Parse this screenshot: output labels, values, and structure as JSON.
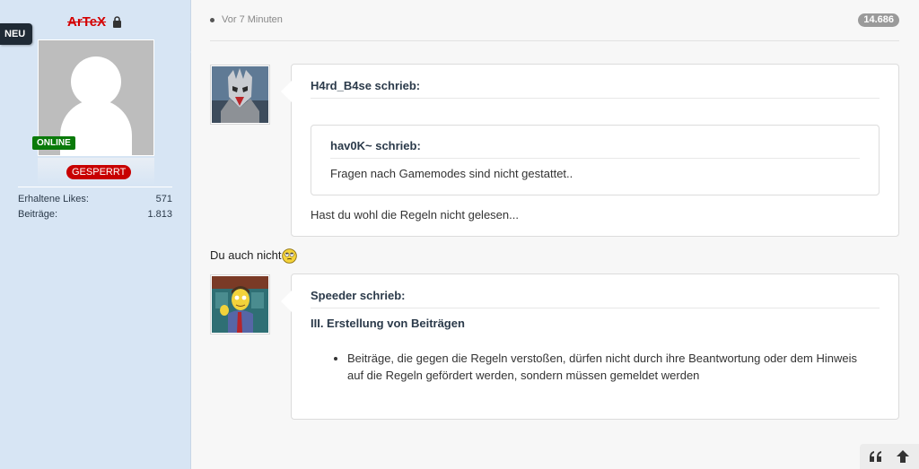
{
  "sidebar": {
    "new_label": "NEU",
    "username": "ArTeX",
    "online_label": "ONLINE",
    "banned_label": "GESPERRT",
    "stats": [
      {
        "label": "Erhaltene Likes:",
        "value": "571"
      },
      {
        "label": "Beiträge:",
        "value": "1.813"
      }
    ]
  },
  "post": {
    "time": "Vor 7 Minuten",
    "views": "14.686",
    "quote1": {
      "author": "H4rd_B4se schrieb:",
      "inner_author": "hav0K~ schrieb:",
      "inner_text": "Fragen nach Gamemodes sind nicht gestattet..",
      "text": "Hast du wohl die Regeln nicht gelesen..."
    },
    "reply": "Du auch nicht",
    "quote2": {
      "author": "Speeder schrieb:",
      "heading": "III. Erstellung von Beiträgen",
      "bullet": "Beiträge, die gegen die Regeln verstoßen, dürfen nicht durch ihre Beantwortung oder dem Hinweis auf die Regeln gefördert werden, sondern müssen gemeldet werden"
    }
  },
  "colors": {
    "sidebar_bg": "#d7e5f4",
    "banned": "#c80000",
    "online": "#0a7a0a",
    "username": "#d40000"
  }
}
